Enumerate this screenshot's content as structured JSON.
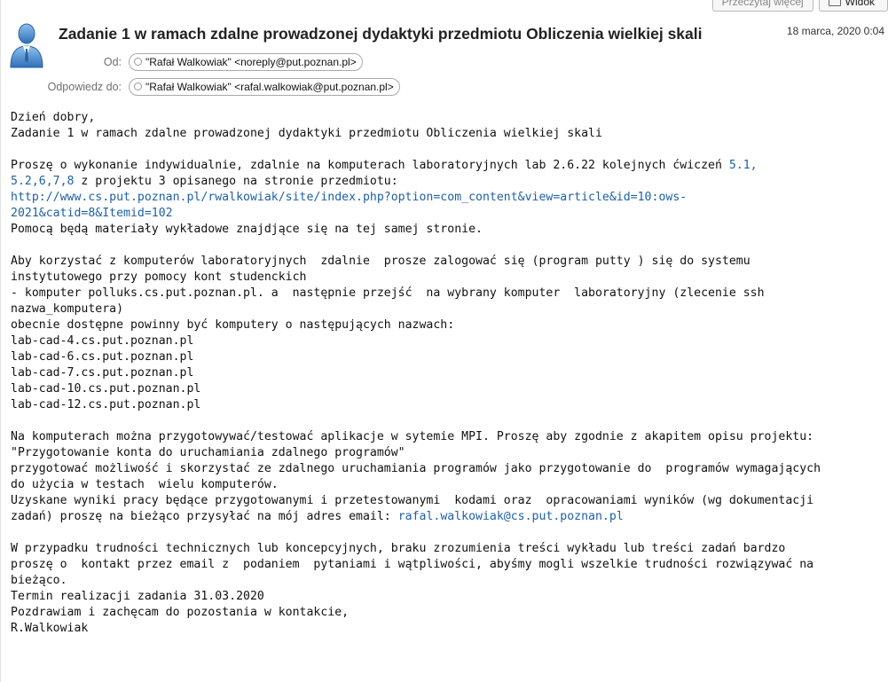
{
  "toolbar": {
    "read_more_label": "Przeczytaj więcej",
    "view_label": "Widok"
  },
  "message": {
    "subject": "Zadanie 1 w ramach zdalne prowadzonej dydaktyki przedmiotu Obliczenia wielkiej skali",
    "date": "18 marca, 2020 0:04",
    "from_label": "Od:",
    "from_value": "\"Rafał Walkowiak\" <noreply@put.poznan.pl>",
    "reply_label": "Odpowiedz do:",
    "reply_value": "\"Rafał Walkowiak\" <rafal.walkowiak@put.poznan.pl>"
  },
  "body": {
    "l01": "Dzień dobry,",
    "l02": "Zadanie 1 w ramach zdalne prowadzonej dydaktyki przedmiotu Obliczenia wielkiej skali",
    "l03a": "Proszę o wykonanie indywidualnie, zdalnie na komputerach laboratoryjnych lab 2.6.22 kolejnych ćwiczeń ",
    "l03link": "5.1,",
    "l04link": "5.2,6,7,8",
    "l04b": " z projektu 3 opisanego na stronie przedmiotu:",
    "url1": "http://www.cs.put.poznan.pl/rwalkowiak/site/index.php?option=com_content&view=article&id=10:ows-",
    "url2": "2021&catid=8&Itemid=102",
    "l07": "Pomocą będą materiały wykładowe znajdjące się na tej samej stronie.",
    "l08": "Aby korzystać z komputerów laboratoryjnych  zdalnie  prosze zalogować się (program putty ) się do systemu",
    "l09": "instytutowego przy pomocy kont studenckich",
    "l10": "- komputer polluks.cs.put.poznan.pl. a  następnie przejść  na wybrany komputer  laboratoryjny (zlecenie ssh",
    "l11": "nazwa_komputera)",
    "l12": "obecnie dostępne powinny być komputery o następujących nazwach:",
    "h1": "lab-cad-4.cs.put.poznan.pl",
    "h2": "lab-cad-6.cs.put.poznan.pl",
    "h3": "lab-cad-7.cs.put.poznan.pl",
    "h4": "lab-cad-10.cs.put.poznan.pl",
    "h5": "lab-cad-12.cs.put.poznan.pl",
    "l18": "Na komputerach można przygotowywać/testować aplikacje w sytemie MPI. Proszę aby zgodnie z akapitem opisu projektu:",
    "l19": "\"Przygotowanie konta do uruchamiania zdalnego programów\"",
    "l20": "przygotować możliwość i skorzystać ze zdalnego uruchamiania programów jako przygotowanie do  programów wymagających",
    "l21": "do użycia w testach  wielu komputerów.",
    "l22": "Uzyskane wyniki pracy będące przygotowanymi i przetestowanymi  kodami oraz  opracowaniami wyników (wg dokumentacji",
    "l23a": "zadań) proszę na bieżąco przysyłać na mój adres email: ",
    "l23link": "rafal.walkowiak@cs.put.poznan.pl",
    "l24": "W przypadku trudności technicznych lub koncepcyjnych, braku zrozumienia treści wykładu lub treści zadań bardzo",
    "l25": "proszę o  kontakt przez email z  podaniem  pytaniami i wątpliwości, abyśmy mogli wszelkie trudności rozwiązywać na",
    "l26": "bieżąco.",
    "l27": "Termin realizacji zadania 31.03.2020",
    "l28": "Pozdrawiam i zachęcam do pozostania w kontakcie,",
    "l29": "R.Walkowiak"
  },
  "colors": {
    "link": "#1f5fa8",
    "avatar": "#3f7fc6"
  },
  "icons": {
    "avatar": "user-avatar-icon",
    "view": "view-icon"
  }
}
